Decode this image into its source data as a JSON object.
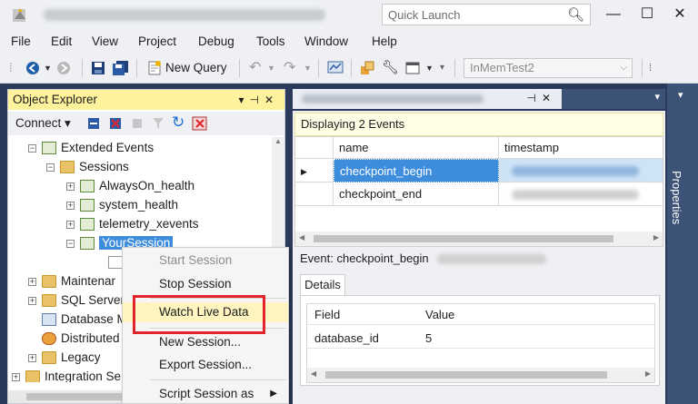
{
  "titlebar": {
    "quick_launch_placeholder": "Quick Launch",
    "minimize": "—",
    "maximize": "☐",
    "close": "✕"
  },
  "menu": [
    "File",
    "Edit",
    "View",
    "Project",
    "Debug",
    "Tools",
    "Window",
    "Help"
  ],
  "toolbar": {
    "new_query": "New Query",
    "database": "InMemTest2"
  },
  "object_explorer": {
    "title": "Object Explorer",
    "connect": "Connect",
    "nodes": {
      "extended_events": "Extended Events",
      "sessions": "Sessions",
      "alwayson": "AlwaysOn_health",
      "system_health": "system_health",
      "telemetry": "telemetry_xevents",
      "your_session": "YourSession",
      "maintenance": "Maintenar",
      "sql_server": "SQL Server",
      "database_mail": "Database M",
      "distributed": "Distributed",
      "legacy": "Legacy",
      "integration": "Integration Se"
    }
  },
  "context_menu": {
    "start_session": "Start Session",
    "stop_session": "Stop Session",
    "watch_live_data": "Watch Live Data",
    "new_session": "New Session...",
    "export_session": "Export Session...",
    "script_session_as": "Script Session as"
  },
  "events_panel": {
    "displaying": "Displaying 2 Events",
    "columns": [
      "name",
      "timestamp"
    ],
    "rows": [
      "checkpoint_begin",
      "checkpoint_end"
    ],
    "event_label": "Event: checkpoint_begin",
    "details_tab": "Details",
    "details_columns": [
      "Field",
      "Value"
    ],
    "details_rows": [
      {
        "field": "database_id",
        "value": "5"
      }
    ]
  },
  "properties_label": "Properties"
}
